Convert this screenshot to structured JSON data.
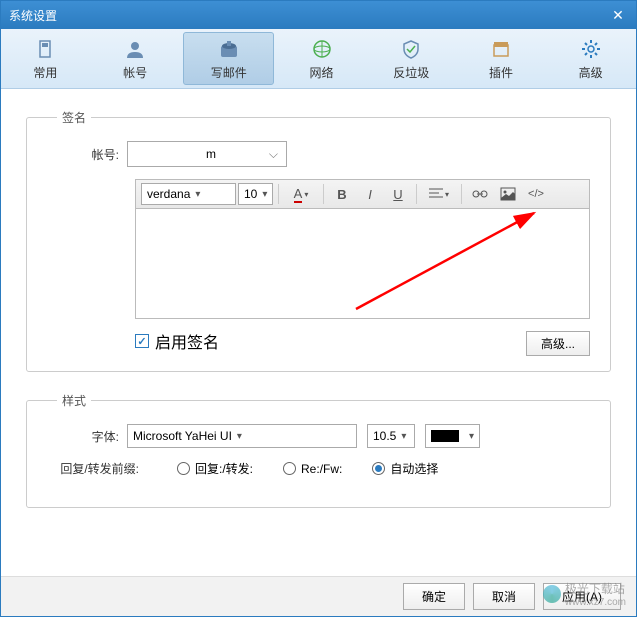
{
  "window": {
    "title": "系统设置"
  },
  "toolbar": {
    "items": [
      {
        "label": "常用"
      },
      {
        "label": "帐号"
      },
      {
        "label": "写邮件"
      },
      {
        "label": "网络"
      },
      {
        "label": "反垃圾"
      },
      {
        "label": "插件"
      },
      {
        "label": "高级"
      }
    ],
    "active_index": 2
  },
  "signature": {
    "legend": "签名",
    "account_label": "帐号:",
    "account_value": "m",
    "editor": {
      "font_name": "verdana",
      "font_size": "10"
    },
    "enable_label": "启用签名",
    "enable_checked": true,
    "advanced_btn": "高级..."
  },
  "style": {
    "legend": "样式",
    "font_label": "字体:",
    "font_value": "Microsoft YaHei UI",
    "font_size": "10.5",
    "color": "#000000",
    "prefix_label": "回复/转发前缀:",
    "options": [
      {
        "label": "回复:/转发:",
        "checked": false
      },
      {
        "label": "Re:/Fw:",
        "checked": false
      },
      {
        "label": "自动选择",
        "checked": true
      }
    ]
  },
  "footer": {
    "ok": "确定",
    "cancel": "取消",
    "apply": "应用(A)"
  },
  "watermark": {
    "text": "极光下载站",
    "url": "www.xz7.com"
  }
}
